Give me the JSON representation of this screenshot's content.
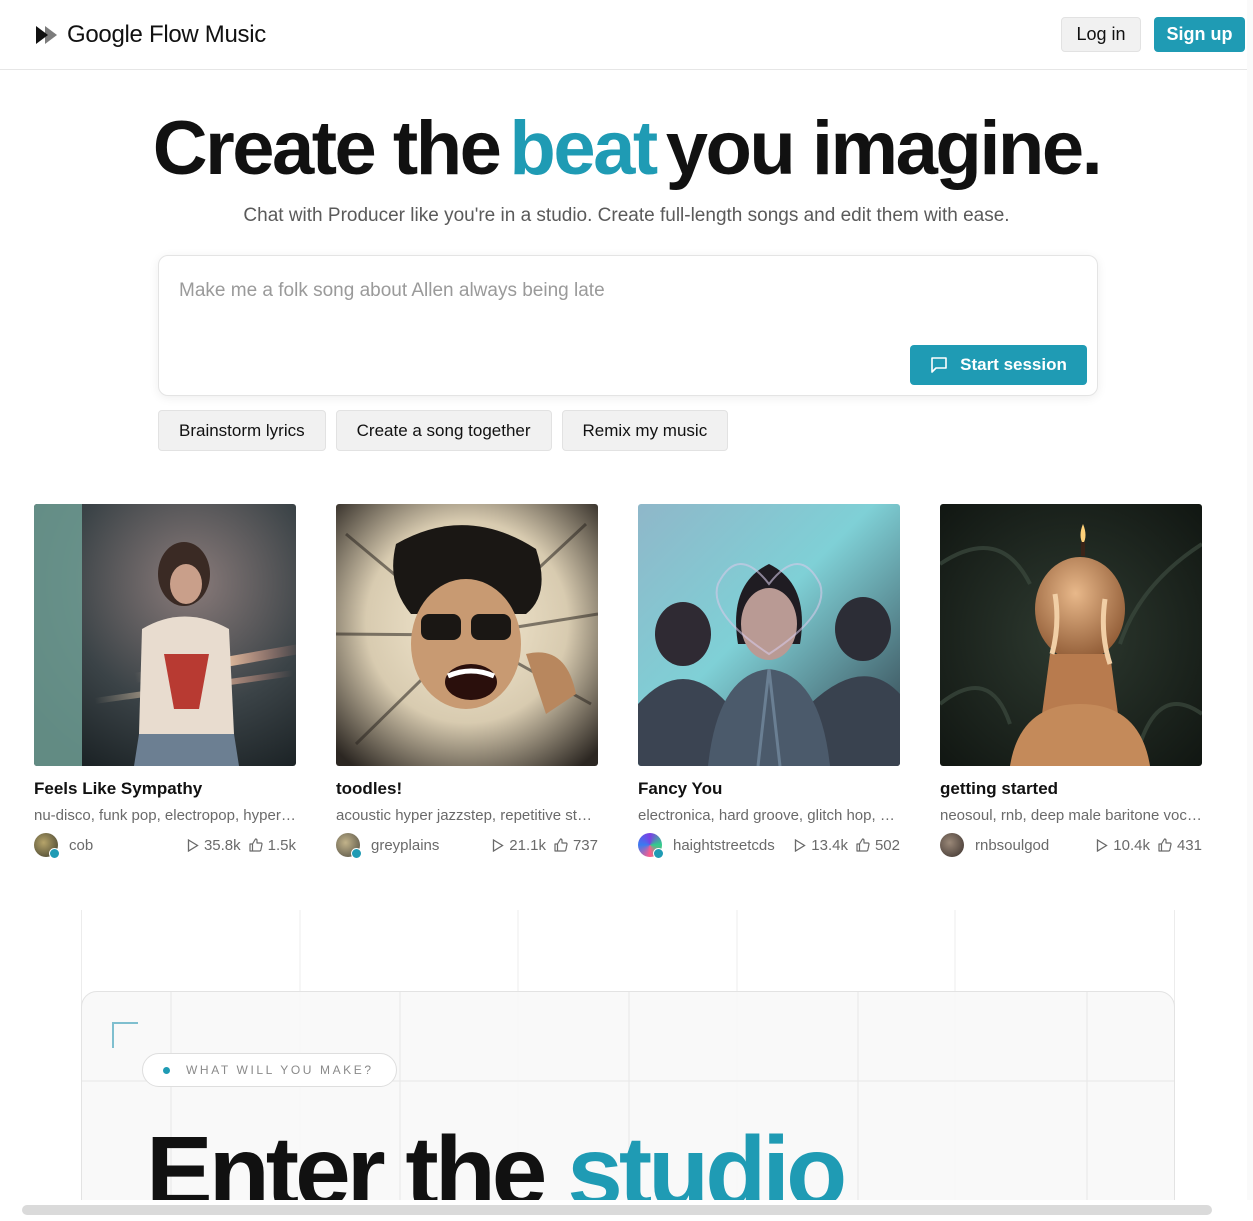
{
  "header": {
    "brand": "Google Flow Music",
    "login_label": "Log in",
    "signup_label": "Sign up",
    "logo_icon": "play-forward-icon"
  },
  "hero": {
    "title_pre": "Create the",
    "title_accent": "beat",
    "title_post": "you imagine.",
    "subtitle": "Chat with Producer like you're in a studio. Create full-length songs and edit them with ease.",
    "accent_color": "#1f9bb4"
  },
  "prompt": {
    "placeholder": "Make me a folk song about Allen always being late",
    "value": "",
    "start_label": "Start session"
  },
  "chips": [
    "Brainstorm lyrics",
    "Create a song together",
    "Remix my music"
  ],
  "songs": [
    {
      "title": "Feels Like Sympathy",
      "genres": "nu-disco, funk pop, electropop, hyperpop, synthwave",
      "user": "cob",
      "plays": "35.8k",
      "likes": "1.5k"
    },
    {
      "title": "toodles!",
      "genres": "acoustic hyper jazzstep, repetitive steady beat",
      "user": "greyplains",
      "plays": "21.1k",
      "likes": "737"
    },
    {
      "title": "Fancy You",
      "genres": "electronica, hard groove, glitch hop, house",
      "user": "haightstreetcds",
      "plays": "13.4k",
      "likes": "502"
    },
    {
      "title": "getting started",
      "genres": "neosoul, rnb, deep male baritone vocals",
      "user": "rnbsoulgod",
      "plays": "10.4k",
      "likes": "431"
    }
  ],
  "studio": {
    "eyebrow": "WHAT WILL YOU MAKE?",
    "title_pre": "Enter the",
    "title_accent": "studio"
  }
}
